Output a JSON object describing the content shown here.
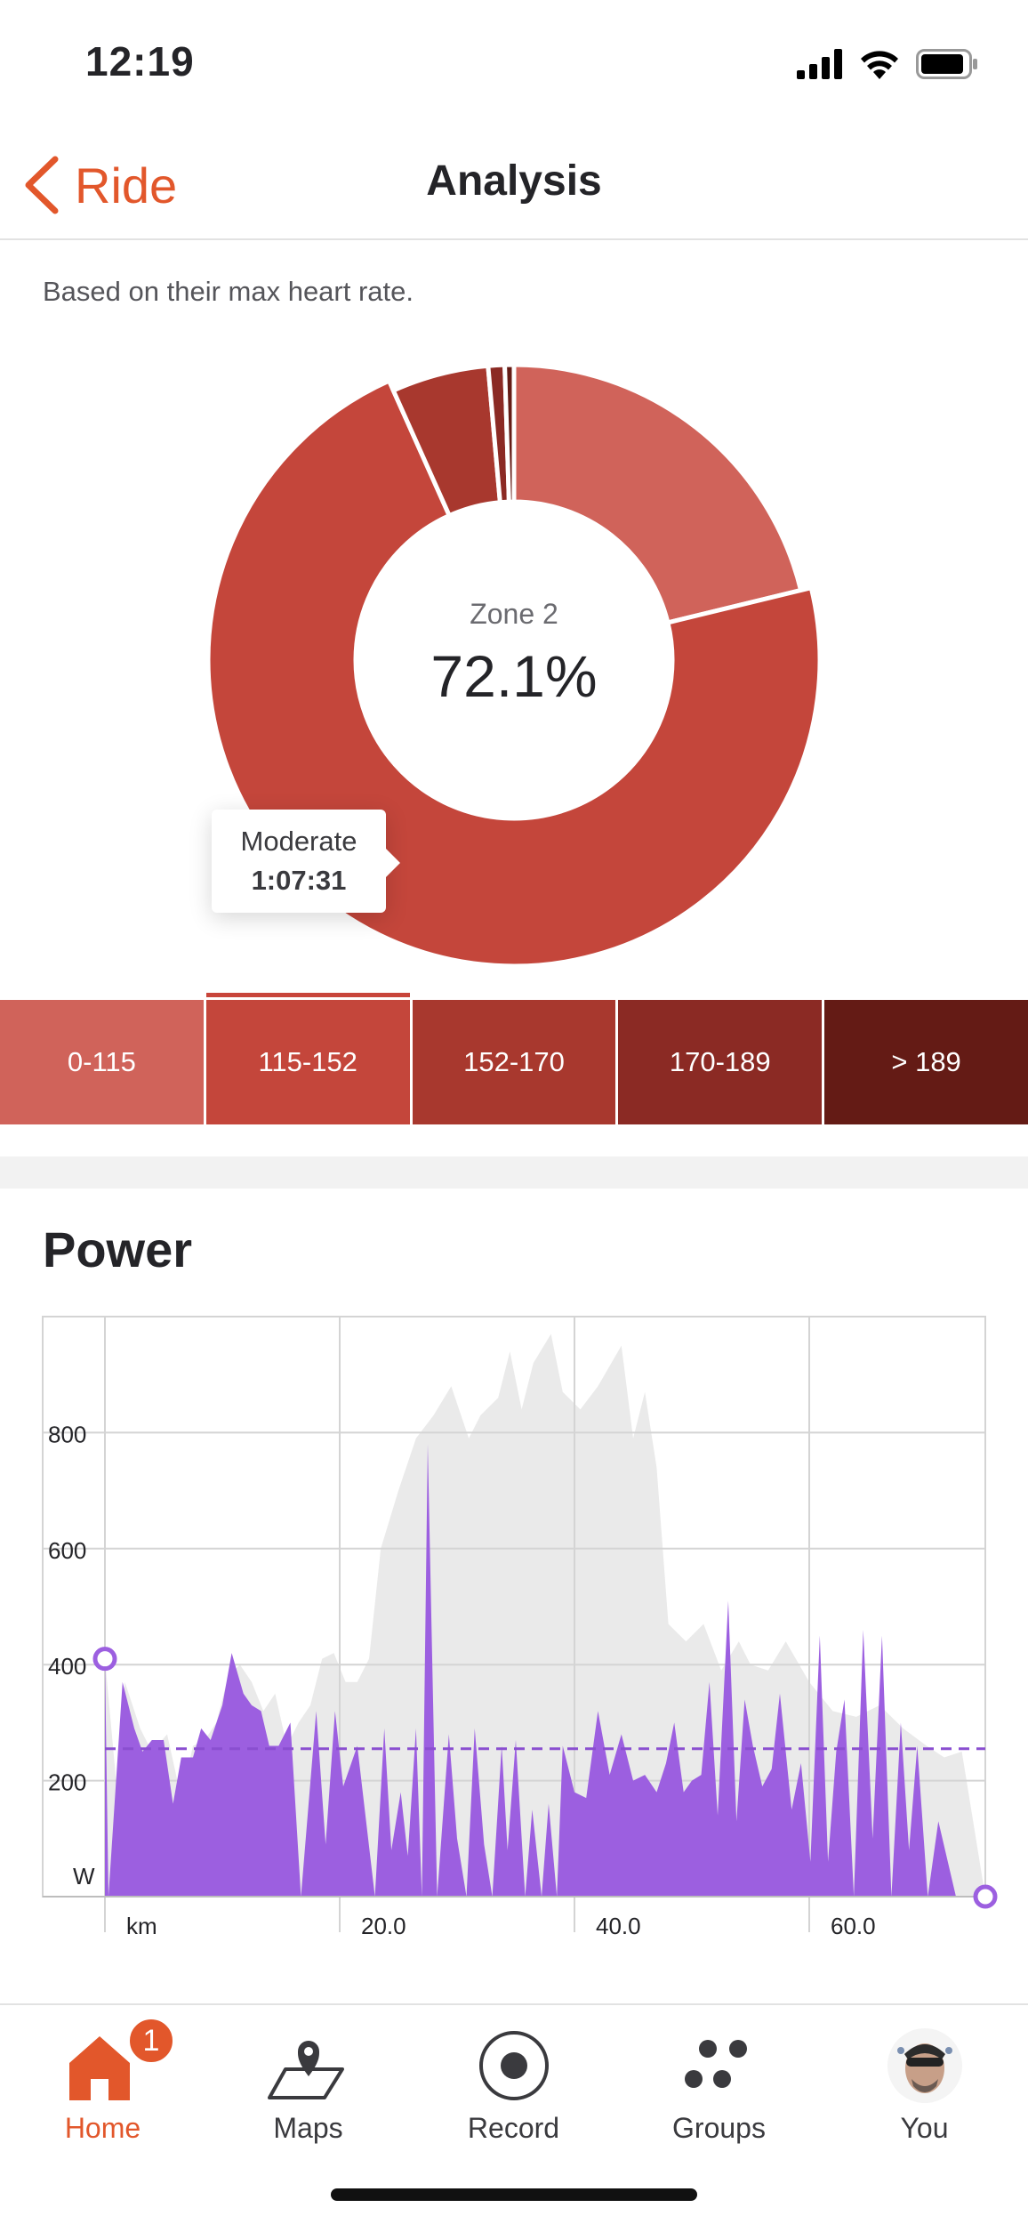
{
  "status_bar": {
    "time": "12:19",
    "icons": [
      "cellular-signal-icon",
      "wifi-icon",
      "battery-icon"
    ]
  },
  "nav": {
    "back_label": "Ride",
    "title": "Analysis"
  },
  "heart_rate": {
    "subtitle": "Based on their max heart rate.",
    "center_label": "Zone 2",
    "center_value": "72.1%",
    "tooltip": {
      "zone": "Moderate",
      "time": "1:07:31"
    },
    "zones": [
      {
        "label": "0-115",
        "color": "#d0635a",
        "share": 0.212
      },
      {
        "label": "115-152",
        "color": "#c4463b",
        "share": 0.721
      },
      {
        "label": "152-170",
        "color": "#a8382e",
        "share": 0.053
      },
      {
        "label": "170-189",
        "color": "#8b2a24",
        "share": 0.009
      },
      {
        "label": "> 189",
        "color": "#641b15",
        "share": 0.005
      }
    ],
    "selected_zone_index": 1
  },
  "power": {
    "title": "Power",
    "unit_label": "W",
    "x_unit_label": "km",
    "colors": {
      "power_fill": "#9c5fe0",
      "elevation_fill": "#eaeaea",
      "average_line": "#8a4fd0",
      "grid": "#d4d4d4"
    }
  },
  "chart_data": {
    "type": "area",
    "ylim": [
      0,
      1000
    ],
    "xlim": [
      0,
      75
    ],
    "y_ticks": [
      200,
      400,
      600,
      800
    ],
    "y_tick_labels": [
      "200",
      "400",
      "600",
      "800"
    ],
    "x_ticks": [
      20,
      40,
      60
    ],
    "x_tick_labels": [
      "20.0",
      "40.0",
      "60.0"
    ],
    "average_power": 255,
    "series": [
      {
        "values": [
          [
            0,
            410
          ],
          [
            1,
            190
          ],
          [
            1.7,
            370
          ],
          [
            3,
            290
          ],
          [
            4,
            250
          ],
          [
            5.3,
            280
          ],
          [
            6.5,
            170
          ],
          [
            7.5,
            260
          ],
          [
            8.5,
            270
          ],
          [
            9.5,
            300
          ],
          [
            10.5,
            380
          ],
          [
            11.5,
            400
          ],
          [
            12.5,
            370
          ],
          [
            13.5,
            320
          ],
          [
            14.5,
            350
          ],
          [
            15.5,
            260
          ],
          [
            16.5,
            300
          ],
          [
            17.5,
            330
          ],
          [
            18.5,
            410
          ],
          [
            19.5,
            420
          ],
          [
            20.5,
            370
          ],
          [
            21.5,
            370
          ],
          [
            22.5,
            410
          ],
          [
            23.5,
            600
          ],
          [
            25,
            700
          ],
          [
            26.5,
            790
          ],
          [
            28,
            830
          ],
          [
            29.5,
            880
          ],
          [
            31,
            790
          ],
          [
            32,
            830
          ],
          [
            33.5,
            860
          ],
          [
            34.5,
            940
          ],
          [
            35.5,
            840
          ],
          [
            36.5,
            920
          ],
          [
            38,
            970
          ],
          [
            39,
            870
          ],
          [
            40.5,
            840
          ],
          [
            42,
            880
          ],
          [
            44,
            950
          ],
          [
            45,
            790
          ],
          [
            46,
            870
          ],
          [
            47,
            740
          ],
          [
            48,
            470
          ],
          [
            49.5,
            440
          ],
          [
            51,
            470
          ],
          [
            52.5,
            390
          ],
          [
            54,
            440
          ],
          [
            55,
            400
          ],
          [
            56.5,
            390
          ],
          [
            58,
            440
          ],
          [
            60,
            370
          ],
          [
            62,
            320
          ],
          [
            64,
            310
          ],
          [
            66,
            330
          ],
          [
            68,
            290
          ],
          [
            70,
            260
          ],
          [
            71.5,
            240
          ],
          [
            73,
            250
          ],
          [
            75,
            0
          ]
        ],
        "role": "elevation background"
      },
      {
        "values": [
          [
            0,
            410
          ],
          [
            0.3,
            0
          ],
          [
            1.5,
            370
          ],
          [
            2.5,
            290
          ],
          [
            3.2,
            250
          ],
          [
            4,
            270
          ],
          [
            5,
            270
          ],
          [
            5.8,
            160
          ],
          [
            6.5,
            240
          ],
          [
            7.5,
            240
          ],
          [
            8.2,
            290
          ],
          [
            9,
            270
          ],
          [
            10,
            330
          ],
          [
            10.8,
            420
          ],
          [
            11.8,
            350
          ],
          [
            12.5,
            330
          ],
          [
            13.3,
            320
          ],
          [
            14,
            260
          ],
          [
            14.8,
            260
          ],
          [
            15.8,
            300
          ],
          [
            16.7,
            0
          ],
          [
            18,
            320
          ],
          [
            18.8,
            90
          ],
          [
            19.6,
            320
          ],
          [
            20.3,
            190
          ],
          [
            21.5,
            260
          ],
          [
            23,
            0
          ],
          [
            23.8,
            290
          ],
          [
            24.4,
            80
          ],
          [
            25.2,
            180
          ],
          [
            25.8,
            70
          ],
          [
            26.5,
            290
          ],
          [
            27,
            0
          ],
          [
            27.5,
            780
          ],
          [
            28.3,
            0
          ],
          [
            29.3,
            280
          ],
          [
            30,
            100
          ],
          [
            30.8,
            0
          ],
          [
            31.5,
            290
          ],
          [
            32.3,
            90
          ],
          [
            33,
            0
          ],
          [
            33.8,
            260
          ],
          [
            34.3,
            80
          ],
          [
            35,
            270
          ],
          [
            35.8,
            0
          ],
          [
            36.4,
            150
          ],
          [
            37.2,
            0
          ],
          [
            37.8,
            160
          ],
          [
            38.5,
            0
          ],
          [
            39,
            260
          ],
          [
            40,
            180
          ],
          [
            41,
            170
          ],
          [
            42,
            320
          ],
          [
            43,
            210
          ],
          [
            44,
            280
          ],
          [
            45,
            200
          ],
          [
            46,
            210
          ],
          [
            47,
            180
          ],
          [
            47.8,
            230
          ],
          [
            48.5,
            300
          ],
          [
            49.3,
            180
          ],
          [
            50,
            200
          ],
          [
            50.8,
            210
          ],
          [
            51.5,
            370
          ],
          [
            52.2,
            140
          ],
          [
            53.1,
            510
          ],
          [
            53.8,
            130
          ],
          [
            54.5,
            340
          ],
          [
            55.2,
            260
          ],
          [
            56,
            190
          ],
          [
            56.8,
            220
          ],
          [
            57.5,
            350
          ],
          [
            58.5,
            150
          ],
          [
            59.3,
            230
          ],
          [
            60.1,
            60
          ],
          [
            60.9,
            450
          ],
          [
            61.6,
            60
          ],
          [
            62.3,
            250
          ],
          [
            63,
            340
          ],
          [
            63.8,
            0
          ],
          [
            64.6,
            460
          ],
          [
            65.4,
            100
          ],
          [
            66.2,
            450
          ],
          [
            67,
            0
          ],
          [
            67.8,
            300
          ],
          [
            68.5,
            80
          ],
          [
            69.2,
            260
          ],
          [
            70.1,
            0
          ],
          [
            71,
            130
          ],
          [
            72.5,
            0
          ],
          [
            75,
            0
          ]
        ],
        "role": "power"
      }
    ]
  },
  "tab_bar": {
    "items": [
      {
        "label": "Home",
        "icon": "home-icon",
        "badge": "1",
        "active": true
      },
      {
        "label": "Maps",
        "icon": "maps-icon",
        "active": false
      },
      {
        "label": "Record",
        "icon": "record-icon",
        "active": false
      },
      {
        "label": "Groups",
        "icon": "groups-icon",
        "active": false
      },
      {
        "label": "You",
        "icon": "avatar",
        "active": false
      }
    ]
  }
}
